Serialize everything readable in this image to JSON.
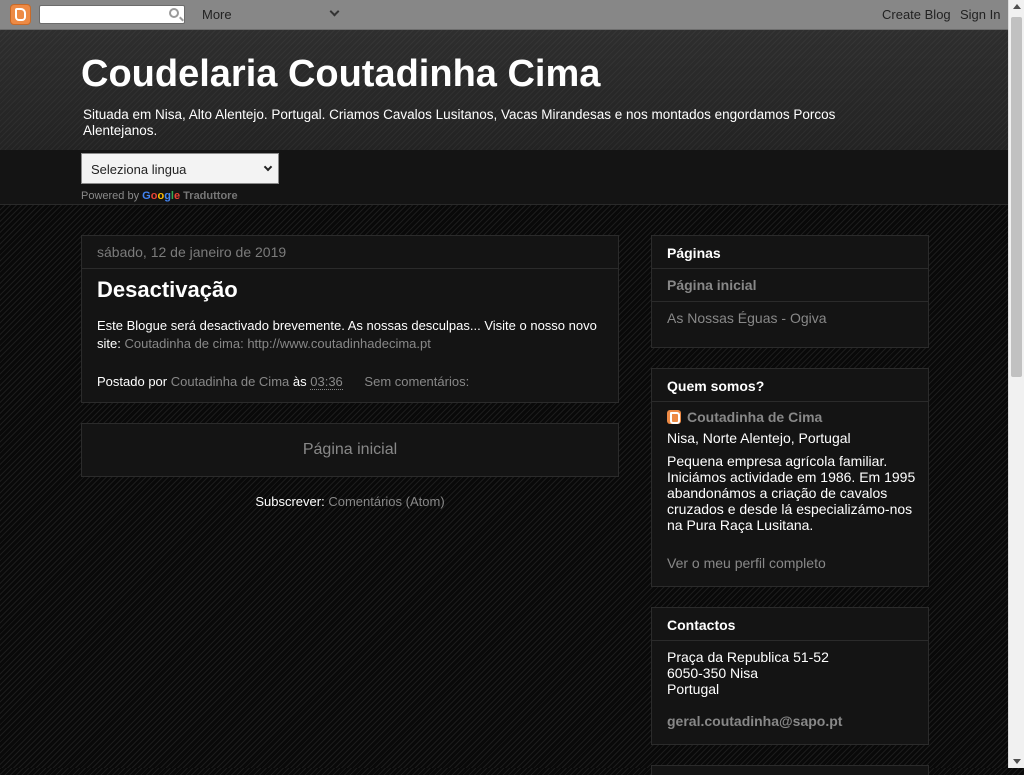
{
  "navbar": {
    "more_label": "More",
    "create_blog": "Create Blog",
    "sign_in": "Sign In"
  },
  "header": {
    "title": "Coudelaria Coutadinha Cima",
    "description": "Situada em Nisa, Alto Alentejo. Portugal. Criamos Cavalos Lusitanos, Vacas Mirandesas e nos montados engordamos Porcos Alentejanos."
  },
  "translate": {
    "selected": "Seleziona lingua",
    "powered_by": "Powered by",
    "google": [
      "G",
      "o",
      "o",
      "g",
      "l",
      "e"
    ],
    "traduttore": "Traduttore"
  },
  "post": {
    "date": "sábado, 12 de janeiro de 2019",
    "title": "Desactivação",
    "body": "Este Blogue será desactivado brevemente. As nossas desculpas... Visite o nosso novo site:",
    "link_text": "Coutadinha de cima: http://www.coutadinhadecima.pt",
    "posted_by": "Postado por",
    "author": "Coutadinha de Cima",
    "at": "às",
    "time": "03:36",
    "comments": "Sem comentários:"
  },
  "pager": {
    "home": "Página inicial"
  },
  "subscribe": {
    "label": "Subscrever:",
    "link": "Comentários (Atom)"
  },
  "sidebar": {
    "pages": {
      "title": "Páginas",
      "items": [
        "Página inicial",
        "As Nossas Éguas - Ogiva"
      ]
    },
    "about": {
      "title": "Quem somos?",
      "name": "Coutadinha de Cima",
      "location": "Nisa, Norte Alentejo, Portugal",
      "bio": "Pequena empresa agrícola familiar. Iniciámos actividade em 1986. Em 1995 abandonámos a criação de cavalos cruzados e desde lá especializámo-nos na Pura Raça Lusitana.",
      "profile_link": "Ver o meu perfil completo"
    },
    "contacts": {
      "title": "Contactos",
      "line1": "Praça da Republica 51-52",
      "line2": "6050-350 Nisa",
      "line3": "Portugal",
      "email": "geral.coutadinha@sapo.pt"
    }
  },
  "colors": {
    "navbar": "#878787",
    "link": "#888888",
    "text": "#ffffff",
    "widget_bg": "#141414",
    "blogger_orange": "#ed8a45"
  }
}
